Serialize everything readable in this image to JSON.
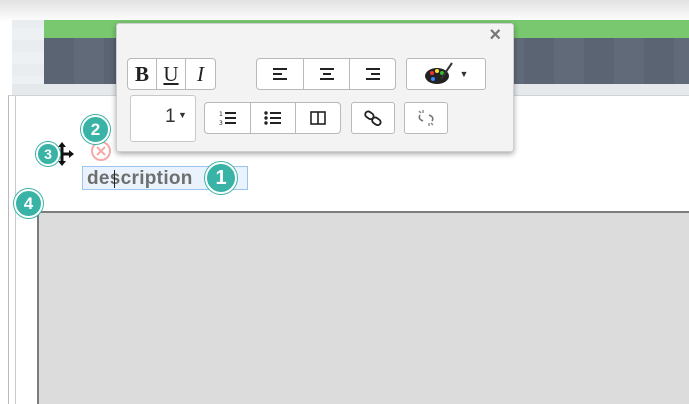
{
  "toolbar": {
    "close_label": "×",
    "bold_label": "B",
    "underline_label": "U",
    "italic_label": "I",
    "font_size_value": "1",
    "icons": [
      "align-left-icon",
      "align-center-icon",
      "align-right-icon",
      "color-palette-icon",
      "ordered-list-icon",
      "unordered-list-icon",
      "columns-icon",
      "link-icon",
      "unlink-icon"
    ]
  },
  "label_field": {
    "value": "description"
  },
  "badges": {
    "b1": "1",
    "b2": "2",
    "b3": "3",
    "b4": "4"
  },
  "colors": {
    "badge": "#39b3a5",
    "banner_green": "#79c86f",
    "banner_slate": "#5a6472",
    "field_border": "#9cc3f0"
  }
}
